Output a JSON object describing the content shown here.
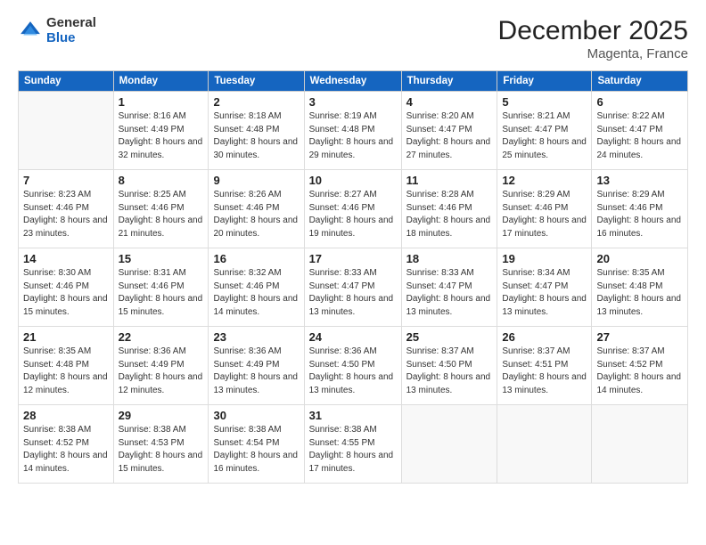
{
  "logo": {
    "general": "General",
    "blue": "Blue"
  },
  "header": {
    "month": "December 2025",
    "location": "Magenta, France"
  },
  "weekdays": [
    "Sunday",
    "Monday",
    "Tuesday",
    "Wednesday",
    "Thursday",
    "Friday",
    "Saturday"
  ],
  "weeks": [
    [
      {
        "day": "",
        "sunrise": "",
        "sunset": "",
        "daylight": ""
      },
      {
        "day": "1",
        "sunrise": "Sunrise: 8:16 AM",
        "sunset": "Sunset: 4:49 PM",
        "daylight": "Daylight: 8 hours and 32 minutes."
      },
      {
        "day": "2",
        "sunrise": "Sunrise: 8:18 AM",
        "sunset": "Sunset: 4:48 PM",
        "daylight": "Daylight: 8 hours and 30 minutes."
      },
      {
        "day": "3",
        "sunrise": "Sunrise: 8:19 AM",
        "sunset": "Sunset: 4:48 PM",
        "daylight": "Daylight: 8 hours and 29 minutes."
      },
      {
        "day": "4",
        "sunrise": "Sunrise: 8:20 AM",
        "sunset": "Sunset: 4:47 PM",
        "daylight": "Daylight: 8 hours and 27 minutes."
      },
      {
        "day": "5",
        "sunrise": "Sunrise: 8:21 AM",
        "sunset": "Sunset: 4:47 PM",
        "daylight": "Daylight: 8 hours and 25 minutes."
      },
      {
        "day": "6",
        "sunrise": "Sunrise: 8:22 AM",
        "sunset": "Sunset: 4:47 PM",
        "daylight": "Daylight: 8 hours and 24 minutes."
      }
    ],
    [
      {
        "day": "7",
        "sunrise": "Sunrise: 8:23 AM",
        "sunset": "Sunset: 4:46 PM",
        "daylight": "Daylight: 8 hours and 23 minutes."
      },
      {
        "day": "8",
        "sunrise": "Sunrise: 8:25 AM",
        "sunset": "Sunset: 4:46 PM",
        "daylight": "Daylight: 8 hours and 21 minutes."
      },
      {
        "day": "9",
        "sunrise": "Sunrise: 8:26 AM",
        "sunset": "Sunset: 4:46 PM",
        "daylight": "Daylight: 8 hours and 20 minutes."
      },
      {
        "day": "10",
        "sunrise": "Sunrise: 8:27 AM",
        "sunset": "Sunset: 4:46 PM",
        "daylight": "Daylight: 8 hours and 19 minutes."
      },
      {
        "day": "11",
        "sunrise": "Sunrise: 8:28 AM",
        "sunset": "Sunset: 4:46 PM",
        "daylight": "Daylight: 8 hours and 18 minutes."
      },
      {
        "day": "12",
        "sunrise": "Sunrise: 8:29 AM",
        "sunset": "Sunset: 4:46 PM",
        "daylight": "Daylight: 8 hours and 17 minutes."
      },
      {
        "day": "13",
        "sunrise": "Sunrise: 8:29 AM",
        "sunset": "Sunset: 4:46 PM",
        "daylight": "Daylight: 8 hours and 16 minutes."
      }
    ],
    [
      {
        "day": "14",
        "sunrise": "Sunrise: 8:30 AM",
        "sunset": "Sunset: 4:46 PM",
        "daylight": "Daylight: 8 hours and 15 minutes."
      },
      {
        "day": "15",
        "sunrise": "Sunrise: 8:31 AM",
        "sunset": "Sunset: 4:46 PM",
        "daylight": "Daylight: 8 hours and 15 minutes."
      },
      {
        "day": "16",
        "sunrise": "Sunrise: 8:32 AM",
        "sunset": "Sunset: 4:46 PM",
        "daylight": "Daylight: 8 hours and 14 minutes."
      },
      {
        "day": "17",
        "sunrise": "Sunrise: 8:33 AM",
        "sunset": "Sunset: 4:47 PM",
        "daylight": "Daylight: 8 hours and 13 minutes."
      },
      {
        "day": "18",
        "sunrise": "Sunrise: 8:33 AM",
        "sunset": "Sunset: 4:47 PM",
        "daylight": "Daylight: 8 hours and 13 minutes."
      },
      {
        "day": "19",
        "sunrise": "Sunrise: 8:34 AM",
        "sunset": "Sunset: 4:47 PM",
        "daylight": "Daylight: 8 hours and 13 minutes."
      },
      {
        "day": "20",
        "sunrise": "Sunrise: 8:35 AM",
        "sunset": "Sunset: 4:48 PM",
        "daylight": "Daylight: 8 hours and 13 minutes."
      }
    ],
    [
      {
        "day": "21",
        "sunrise": "Sunrise: 8:35 AM",
        "sunset": "Sunset: 4:48 PM",
        "daylight": "Daylight: 8 hours and 12 minutes."
      },
      {
        "day": "22",
        "sunrise": "Sunrise: 8:36 AM",
        "sunset": "Sunset: 4:49 PM",
        "daylight": "Daylight: 8 hours and 12 minutes."
      },
      {
        "day": "23",
        "sunrise": "Sunrise: 8:36 AM",
        "sunset": "Sunset: 4:49 PM",
        "daylight": "Daylight: 8 hours and 13 minutes."
      },
      {
        "day": "24",
        "sunrise": "Sunrise: 8:36 AM",
        "sunset": "Sunset: 4:50 PM",
        "daylight": "Daylight: 8 hours and 13 minutes."
      },
      {
        "day": "25",
        "sunrise": "Sunrise: 8:37 AM",
        "sunset": "Sunset: 4:50 PM",
        "daylight": "Daylight: 8 hours and 13 minutes."
      },
      {
        "day": "26",
        "sunrise": "Sunrise: 8:37 AM",
        "sunset": "Sunset: 4:51 PM",
        "daylight": "Daylight: 8 hours and 13 minutes."
      },
      {
        "day": "27",
        "sunrise": "Sunrise: 8:37 AM",
        "sunset": "Sunset: 4:52 PM",
        "daylight": "Daylight: 8 hours and 14 minutes."
      }
    ],
    [
      {
        "day": "28",
        "sunrise": "Sunrise: 8:38 AM",
        "sunset": "Sunset: 4:52 PM",
        "daylight": "Daylight: 8 hours and 14 minutes."
      },
      {
        "day": "29",
        "sunrise": "Sunrise: 8:38 AM",
        "sunset": "Sunset: 4:53 PM",
        "daylight": "Daylight: 8 hours and 15 minutes."
      },
      {
        "day": "30",
        "sunrise": "Sunrise: 8:38 AM",
        "sunset": "Sunset: 4:54 PM",
        "daylight": "Daylight: 8 hours and 16 minutes."
      },
      {
        "day": "31",
        "sunrise": "Sunrise: 8:38 AM",
        "sunset": "Sunset: 4:55 PM",
        "daylight": "Daylight: 8 hours and 17 minutes."
      },
      {
        "day": "",
        "sunrise": "",
        "sunset": "",
        "daylight": ""
      },
      {
        "day": "",
        "sunrise": "",
        "sunset": "",
        "daylight": ""
      },
      {
        "day": "",
        "sunrise": "",
        "sunset": "",
        "daylight": ""
      }
    ]
  ]
}
